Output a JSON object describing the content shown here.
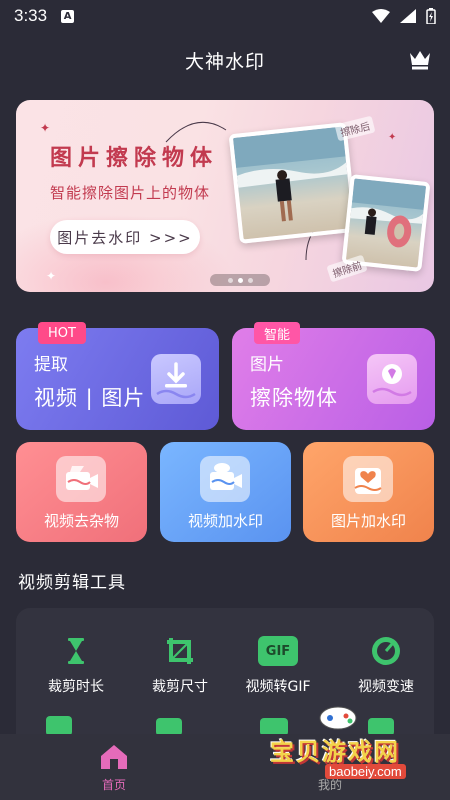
{
  "status": {
    "time": "3:33",
    "a_label": "A"
  },
  "header": {
    "title": "大神水印"
  },
  "banner": {
    "title": "图片擦除物体",
    "subtitle": "智能擦除图片上的物体",
    "button": "图片去水印 >>>",
    "tag_after": "擦除后",
    "tag_before": "擦除前",
    "page_index": 2,
    "page_count": 3
  },
  "big_cards": [
    {
      "badge": "HOT",
      "line1": "提取",
      "line2": "视频 | 图片"
    },
    {
      "badge": "智能",
      "line1": "图片",
      "line2": "擦除物体"
    }
  ],
  "small_cards": [
    {
      "label": "视频去杂物"
    },
    {
      "label": "视频加水印"
    },
    {
      "label": "图片加水印"
    }
  ],
  "tools_section": {
    "title": "视频剪辑工具",
    "tools": [
      {
        "label": "裁剪时长",
        "icon": "hourglass-icon"
      },
      {
        "label": "裁剪尺寸",
        "icon": "crop-icon"
      },
      {
        "label": "视频转GIF",
        "icon": "gif-icon"
      },
      {
        "label": "视频变速",
        "icon": "speedometer-icon"
      }
    ],
    "gif_text": "GIF"
  },
  "bottom_nav": {
    "home": "首页",
    "mine": "我的"
  },
  "watermark": {
    "text": "宝贝游戏网",
    "url": "baobeiy.com"
  },
  "colors": {
    "background": "#2b2b37",
    "accent_pink": "#e56bba",
    "banner_red": "#c23a4f",
    "tool_green": "#3ec46d"
  }
}
